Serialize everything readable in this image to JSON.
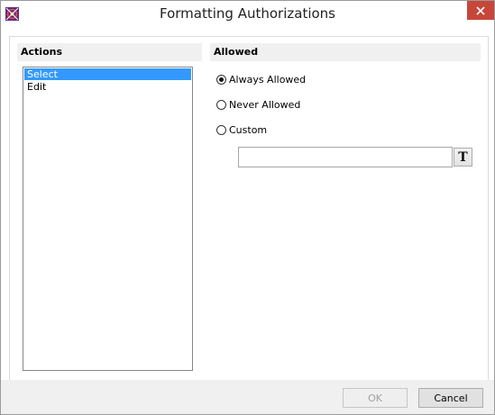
{
  "window": {
    "title": "Formatting Authorizations"
  },
  "actions": {
    "header": "Actions",
    "items": [
      {
        "label": "Select",
        "selected": true
      },
      {
        "label": "Edit",
        "selected": false
      }
    ]
  },
  "allowed": {
    "header": "Allowed",
    "options": [
      {
        "label": "Always Allowed",
        "checked": true
      },
      {
        "label": "Never Allowed",
        "checked": false
      },
      {
        "label": "Custom",
        "checked": false
      }
    ],
    "custom_value": "",
    "format_button_glyph": "T"
  },
  "footer": {
    "ok_label": "OK",
    "cancel_label": "Cancel"
  },
  "colors": {
    "selection": "#3399ff",
    "close_button": "#c7463a",
    "header_bg": "#f0f0f0"
  },
  "icons": {
    "app": "app-logo-icon",
    "close": "close-icon",
    "format": "text-format-icon"
  }
}
